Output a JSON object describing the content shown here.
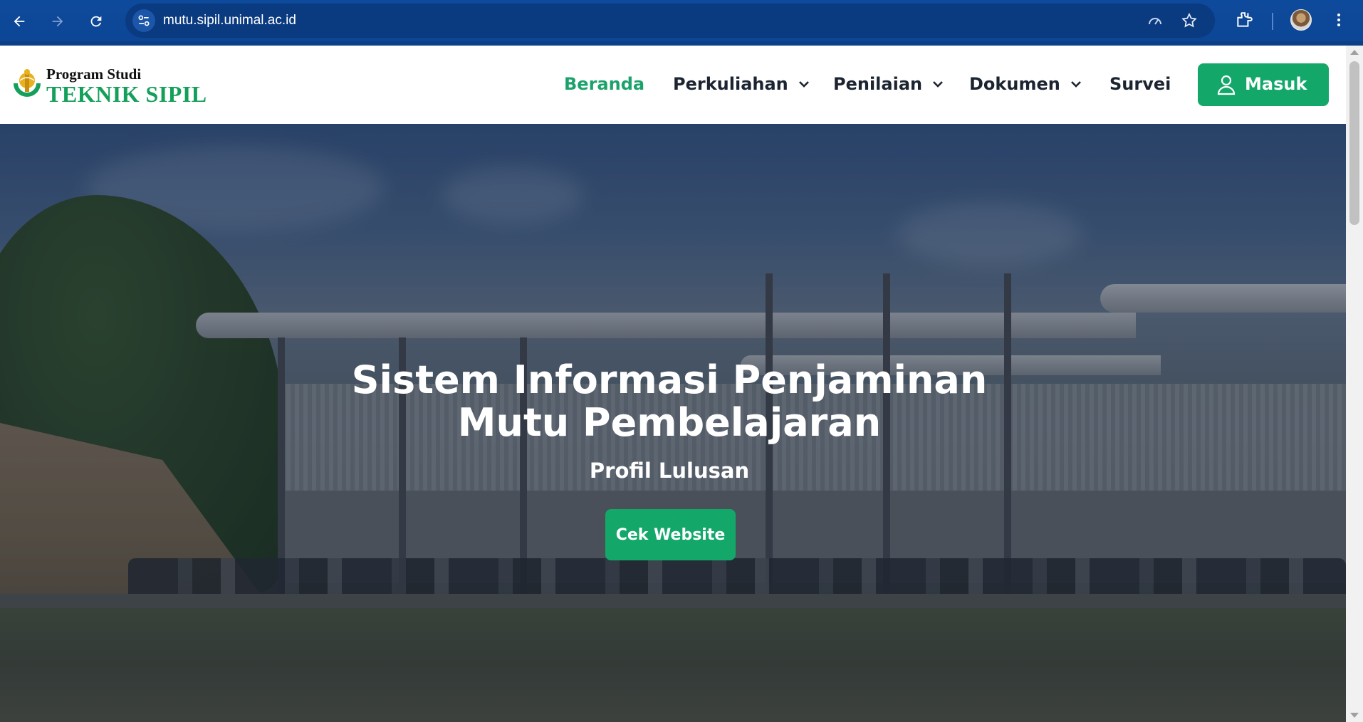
{
  "browser": {
    "url": "mutu.sipil.unimal.ac.id",
    "icons": [
      "back-arrow-icon",
      "forward-arrow-icon",
      "reload-icon",
      "site-info-icon",
      "performance-icon",
      "bookmark-star-icon",
      "extensions-icon",
      "profile-avatar",
      "kebab-menu-icon"
    ]
  },
  "logo": {
    "line1": "Program Studi",
    "line2": "TEKNIK SIPIL"
  },
  "nav": {
    "items": [
      {
        "label": "Beranda",
        "active": true
      },
      {
        "label": "Perkuliahan",
        "dropdown": true
      },
      {
        "label": "Penilaian",
        "dropdown": true
      },
      {
        "label": "Dokumen",
        "dropdown": true
      },
      {
        "label": "Survei"
      }
    ],
    "login_label": "Masuk"
  },
  "hero": {
    "title_line1": "Sistem Informasi Penjaminan",
    "title_line2": "Mutu Pembelajaran",
    "subtitle": "Profil Lulusan",
    "button_label": "Cek Website"
  },
  "colors": {
    "brand_green": "#13a86a",
    "active_link": "#1ba26a",
    "chrome_blue": "#0e4a9c"
  }
}
